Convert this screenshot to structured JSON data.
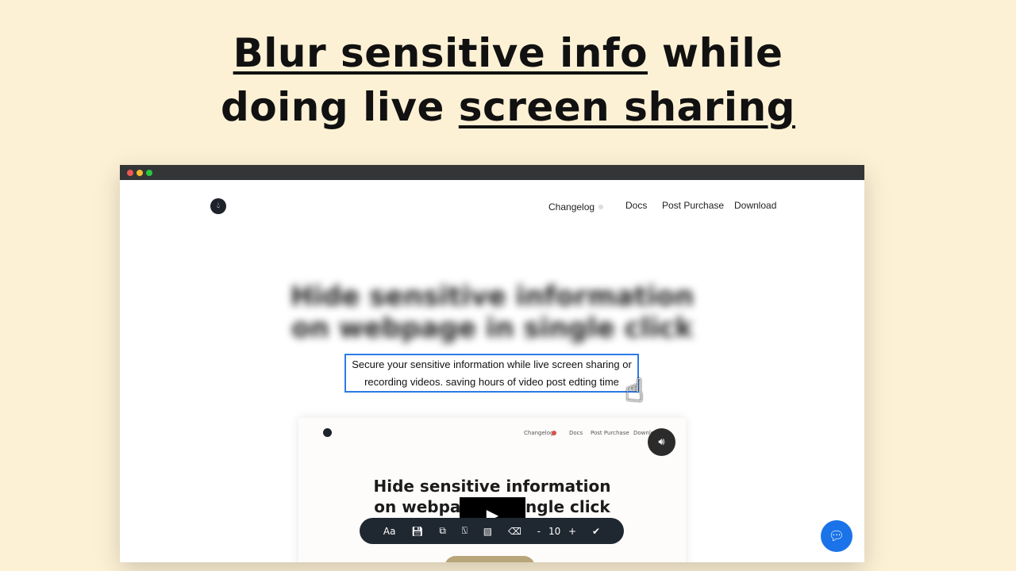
{
  "headline": {
    "line1_underlined": "Blur sensitive info",
    "line1_rest": " while",
    "line2_plain": "doing live ",
    "line2_underlined": "screen sharing"
  },
  "window": {
    "dots": [
      "#ee5a52",
      "#f5bd2f",
      "#28c840"
    ]
  },
  "site": {
    "logo_icon": "drop-icon",
    "nav": [
      "Changelog",
      "Docs",
      "Post Purchase",
      "Download"
    ],
    "blurred_title_line1": "Hide sensitive information",
    "blurred_title_line2": "on webpage in single click",
    "selected_text_line1": "Secure your sensitive information while live screen sharing or",
    "selected_text_line2": "recording videos. saving hours of video post edting time"
  },
  "preview": {
    "nav": [
      "Changelog",
      "Docs",
      "Post Purchase",
      "Download"
    ],
    "title_line1": "Hide sensitive information",
    "title_line2": "on webpage in single click",
    "sound_icon": "speaker-icon",
    "play_icon": "play-icon"
  },
  "toolbar": {
    "text_label": "Aa",
    "size_minus": "-",
    "size_value": "10",
    "size_plus": "+"
  },
  "chat_icon": "chat-bubble-icon"
}
